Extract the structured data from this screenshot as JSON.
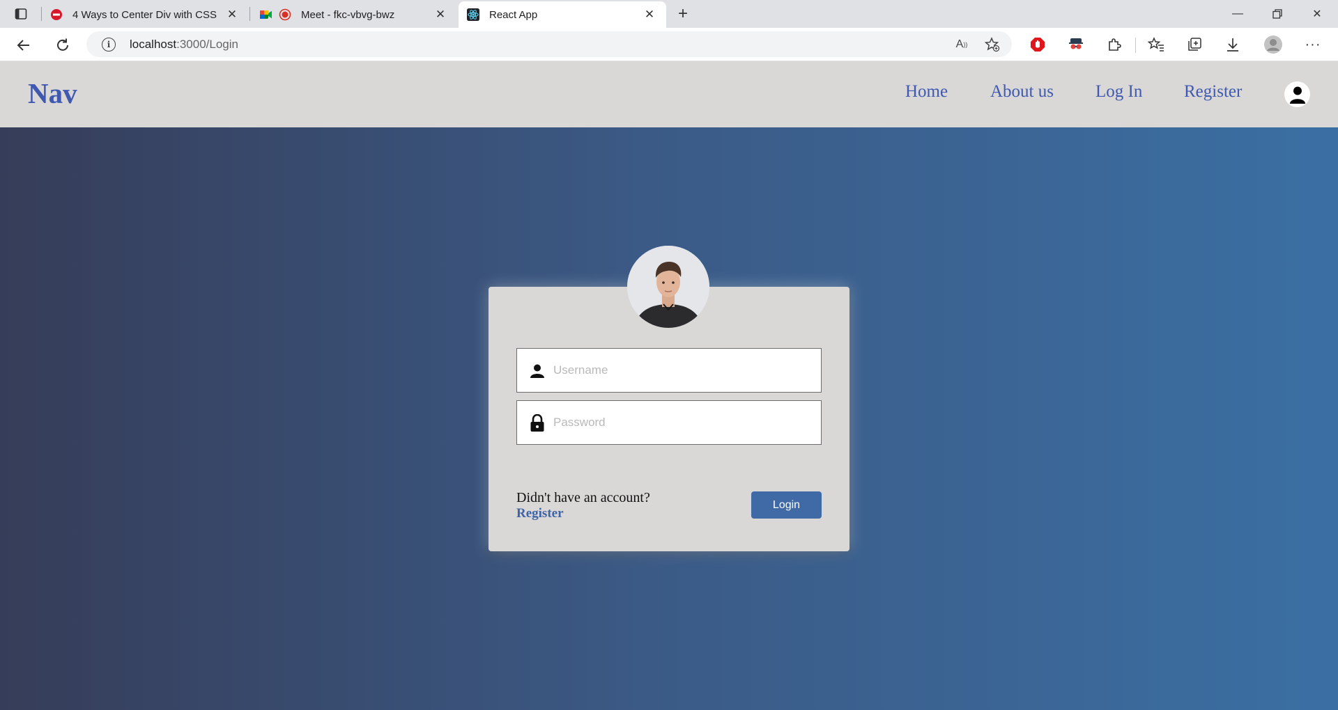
{
  "browser": {
    "tabs": [
      {
        "title": "4 Ways to Center Div with CSS - ",
        "favicon": "red-stop-icon"
      },
      {
        "title": "Meet - fkc-vbvg-bwz",
        "favicon": "google-meet-icon"
      },
      {
        "title": "React App",
        "favicon": "react-icon",
        "active": true
      }
    ],
    "url": {
      "host": "localhost",
      "path": ":3000/Login"
    }
  },
  "navbar": {
    "brand": "Nav",
    "links": [
      "Home",
      "About us",
      "Log In",
      "Register"
    ]
  },
  "login": {
    "username_placeholder": "Username",
    "password_placeholder": "Password",
    "prompt": "Didn't have an account?",
    "register_link": "Register",
    "login_button": "Login"
  },
  "colors": {
    "nav_link": "#3f58b0",
    "button": "#3f6aa5",
    "gradient_start": "#363d59",
    "gradient_end": "#3b6fa3",
    "card": "#d9d8d6"
  }
}
